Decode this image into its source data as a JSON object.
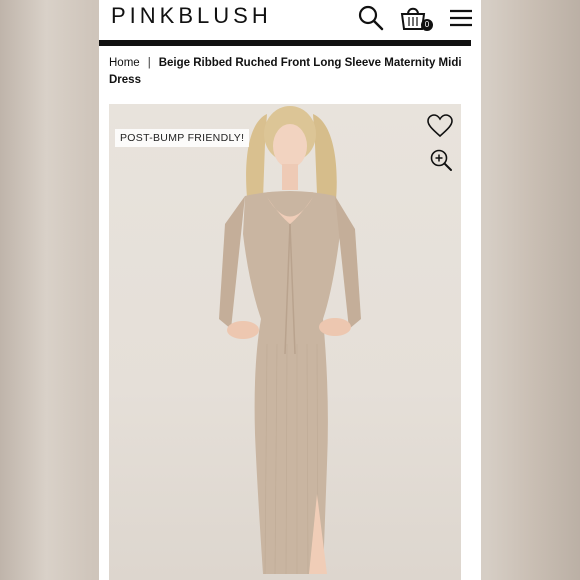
{
  "header": {
    "logo": "PINKBLUSH",
    "bag_count": "0",
    "icons": [
      "search-icon",
      "shopping-bag-icon",
      "menu-icon"
    ]
  },
  "breadcrumb": {
    "home": "Home",
    "separator": "|",
    "current": "Beige Ribbed Ruched Front Long Sleeve Maternity Midi Dress"
  },
  "product": {
    "badge": "POST-BUMP FRIENDLY!",
    "actions": [
      "heart-icon",
      "zoom-in-icon"
    ]
  },
  "colors": {
    "brand_text": "#111111",
    "dress": "#c7b29e",
    "background": "#e8e3dc"
  }
}
